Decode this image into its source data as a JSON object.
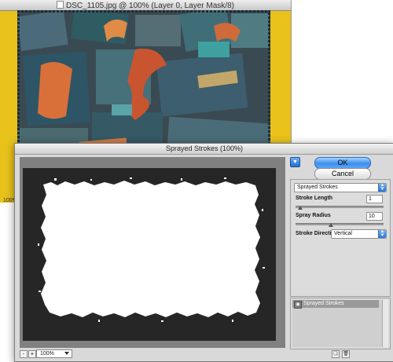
{
  "document": {
    "title": "DSC_1105.jpg @ 100% (Layer 0, Layer Mask/8)",
    "zoom": "100%"
  },
  "dialog": {
    "title": "Sprayed Strokes (100%)",
    "ok_label": "OK",
    "cancel_label": "Cancel",
    "collapse_icon": "triangle-down-icon",
    "preview": {
      "zoom_value": "100%",
      "zoom_out_label": "-",
      "zoom_in_label": "+"
    },
    "filter_select": "Sprayed Strokes",
    "params": {
      "stroke_length": {
        "label": "Stroke Length",
        "value": "1",
        "fraction": 0.05
      },
      "spray_radius": {
        "label": "Spray Radius",
        "value": "10",
        "fraction": 0.4
      },
      "stroke_direction": {
        "label": "Stroke Direction:",
        "value": "Vertical"
      }
    },
    "layers": {
      "items": [
        {
          "label": "Sprayed Strokes"
        }
      ]
    },
    "new_layer_icon": "new-effect-layer-icon",
    "delete_layer_icon": "trash-icon"
  },
  "colors": {
    "doc_background": "#e8c21a",
    "accent_blue": "#3b8ff0"
  }
}
